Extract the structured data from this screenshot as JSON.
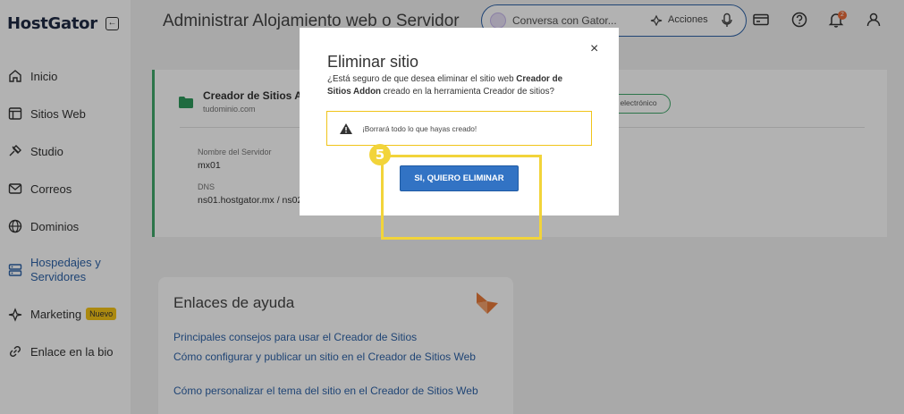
{
  "app": {
    "logo": "HostGator",
    "collapse_icon": "collapse-sidebar-icon"
  },
  "sidebar": {
    "items": [
      {
        "label": "Inicio",
        "icon": "home-icon"
      },
      {
        "label": "Sitios Web",
        "icon": "website-icon"
      },
      {
        "label": "Studio",
        "icon": "studio-icon"
      },
      {
        "label": "Correos",
        "icon": "mail-icon"
      },
      {
        "label": "Dominios",
        "icon": "globe-icon"
      },
      {
        "label": "Hospedajes y Servidores",
        "icon": "servers-icon",
        "active": true
      },
      {
        "label": "Marketing",
        "icon": "marketing-icon",
        "badge": "Nuevo"
      },
      {
        "label": "Enlace en la bio",
        "icon": "link-icon"
      }
    ]
  },
  "header": {
    "title": "Administrar Alojamiento web o Servidor",
    "search_placeholder": "Conversa con Gator...",
    "actions_label": "Acciones",
    "notification_count": "2"
  },
  "site_card": {
    "name": "Creador de Sitios Ad",
    "domain": "tudominio.com",
    "pill_button": "electrónico",
    "server_name_label": "Nombre del Servidor",
    "server_name_value": "mx01",
    "dns_label": "DNS",
    "dns_value": "ns01.hostgator.mx / ns02"
  },
  "help": {
    "title": "Enlaces de ayuda",
    "links": [
      "Principales consejos para usar el Creador de Sitios",
      "Cómo configurar y publicar un sitio en el Creador de Sitios Web",
      "Cómo personalizar el tema del sitio en el Creador de Sitios Web"
    ]
  },
  "modal": {
    "title": "Eliminar sitio",
    "close": "×",
    "body_prefix": "¿Está seguro de que desea eliminar el sitio web ",
    "body_bold": "Creador de Sitios Addon",
    "body_suffix": " creado en la herramienta Creador de sitios?",
    "warning": "¡Borrará todo lo que hayas creado!",
    "confirm_button": "SI, QUIERO ELIMINAR"
  },
  "tutorial": {
    "step": "5",
    "highlight_color": "#f2d43a"
  },
  "colors": {
    "brand_blue": "#2e63a8",
    "accent_green": "#3fa86b",
    "button_blue": "#3273c4",
    "warning_yellow": "#f0c419"
  }
}
